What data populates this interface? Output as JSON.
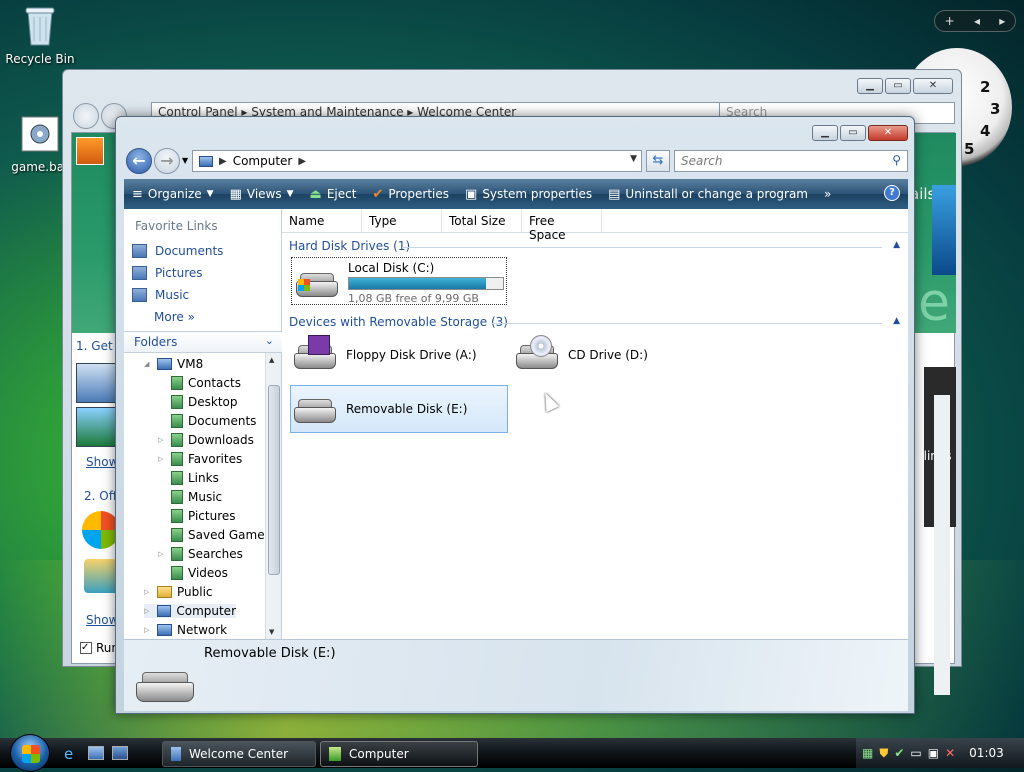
{
  "desktop": {
    "icons": [
      {
        "label": "Recycle Bin"
      },
      {
        "label": "game.bat"
      }
    ],
    "sidebar_controls": {
      "add": "+",
      "prev": "◂",
      "next": "▸"
    },
    "clock_numbers": [
      "2",
      "3",
      "4",
      "5"
    ]
  },
  "welcome_center": {
    "breadcrumb": [
      "Control Panel",
      "System and Maintenance",
      "Welcome Center"
    ],
    "search_placeholder": "Search",
    "left_text": [
      "1. Get",
      "Show",
      "2. Offe",
      "Show",
      "Run"
    ],
    "right_text": [
      "ails",
      "e",
      "dlines"
    ]
  },
  "computer_window": {
    "address": {
      "location": "Computer"
    },
    "search_placeholder": "Search",
    "commands": [
      {
        "label": "Organize",
        "icon": "≡",
        "dropdown": true
      },
      {
        "label": "Views",
        "icon": "▦",
        "dropdown": true
      },
      {
        "label": "Eject",
        "icon": "⏏"
      },
      {
        "label": "Properties",
        "icon": "✔"
      },
      {
        "label": "System properties",
        "icon": "▣"
      },
      {
        "label": "Uninstall or change a program",
        "icon": "▤"
      }
    ],
    "overflow": "»",
    "favorite_links": {
      "title": "Favorite Links",
      "items": [
        "Documents",
        "Pictures",
        "Music"
      ],
      "more": "More"
    },
    "folders": {
      "title": "Folders",
      "tree": [
        {
          "label": "VM8",
          "type": "pc",
          "toggle": "◢"
        },
        {
          "label": "Contacts",
          "type": "file"
        },
        {
          "label": "Desktop",
          "type": "file"
        },
        {
          "label": "Documents",
          "type": "file"
        },
        {
          "label": "Downloads",
          "type": "file",
          "toggle": "▷"
        },
        {
          "label": "Favorites",
          "type": "file",
          "toggle": "▷"
        },
        {
          "label": "Links",
          "type": "file"
        },
        {
          "label": "Music",
          "type": "file"
        },
        {
          "label": "Pictures",
          "type": "file"
        },
        {
          "label": "Saved Games",
          "type": "file"
        },
        {
          "label": "Searches",
          "type": "file",
          "toggle": "▷"
        },
        {
          "label": "Videos",
          "type": "file"
        },
        {
          "label": "Public",
          "type": "folder",
          "toggle": "▷"
        },
        {
          "label": "Computer",
          "type": "pc",
          "toggle": "▷",
          "selected": true
        },
        {
          "label": "Network",
          "type": "pc",
          "toggle": "▷"
        }
      ]
    },
    "columns": [
      "Name",
      "Type",
      "Total Size",
      "Free Space"
    ],
    "groups": [
      {
        "title": "Hard Disk Drives (1)"
      },
      {
        "title": "Devices with Removable Storage (3)"
      }
    ],
    "drives": [
      {
        "name": "Local Disk (C:)",
        "free": "1,08 GB free of 9,99 GB",
        "used_fraction": 0.89
      },
      {
        "name": "Floppy Disk Drive (A:)"
      },
      {
        "name": "CD Drive (D:)"
      },
      {
        "name": "Removable Disk (E:)"
      }
    ],
    "details": {
      "name": "Removable Disk (E:)"
    }
  },
  "taskbar": {
    "buttons": [
      {
        "label": "Welcome Center"
      },
      {
        "label": "Computer"
      }
    ],
    "time": "01:03"
  }
}
